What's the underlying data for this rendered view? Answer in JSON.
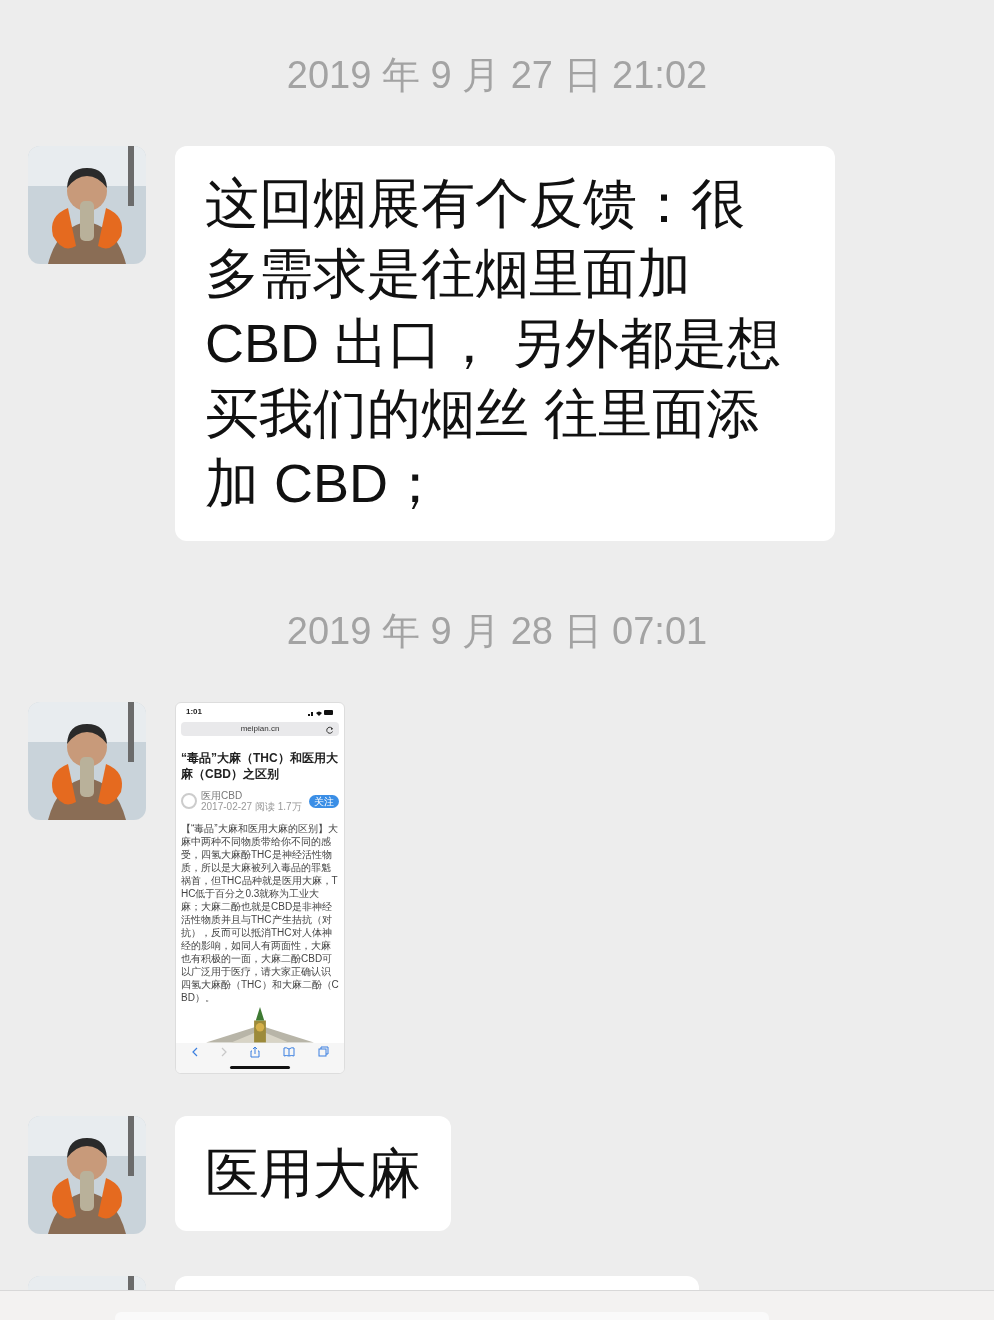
{
  "messages": [
    {
      "kind": "time",
      "text": "2019 年 9 月 27 日 21:02"
    },
    {
      "kind": "text",
      "lines": [
        "这回烟展有个反馈：很",
        "多需求是往烟里面加",
        "CBD 出口， 另外都是想",
        "买我们的烟丝 往里面添",
        "加 CBD；"
      ]
    },
    {
      "kind": "time",
      "text": "2019 年 9 月 28 日 07:01"
    },
    {
      "kind": "screenshot",
      "screenshot": {
        "clock": "1:01",
        "url": "meipian.cn",
        "title": "“毒品”大麻（THC）和医用大麻（CBD）之区别",
        "author": "医用CBD",
        "meta": "2017-02-27  阅读 1.7万",
        "follow": "关注",
        "body": "【“毒品”大麻和医用大麻的区别】大麻中两种不同物质带给你不同的感受，四氢大麻酚THC是神经活性物质，所以是大麻被列入毒品的罪魁祸首，但THC品种就是医用大麻，THC低于百分之0.3就称为工业大麻；大麻二酚也就是CBD是非神经活性物质并且与THC产生拮抗（对抗），反而可以抵消THC对人体神经的影响，如同人有两面性，大麻也有积极的一面，大麻二酚CBD可以广泛用于医疗，请大家正确认识四氢大麻酚（THC）和大麻二酚（CBD）。"
      }
    },
    {
      "kind": "text",
      "lines": [
        "医用大麻"
      ]
    },
    {
      "kind": "partial"
    }
  ]
}
